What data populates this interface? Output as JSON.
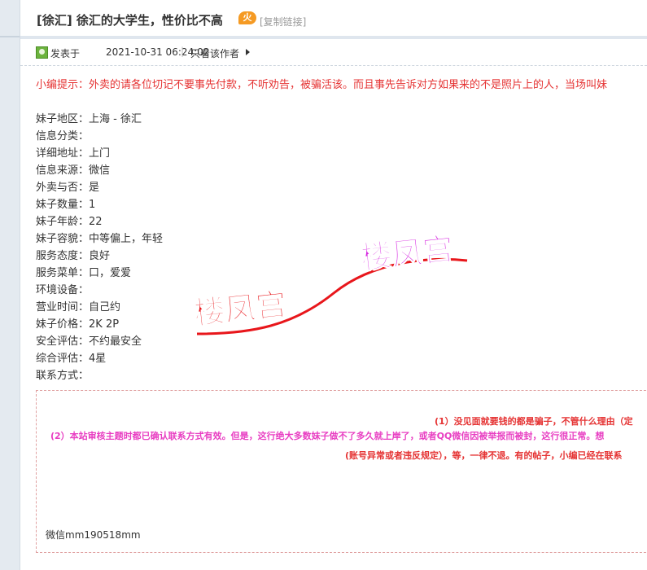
{
  "thread": {
    "title": "[徐汇] 徐汇的大学生，性价比不高",
    "hot_badge": "火",
    "copy_link": "[复制链接]"
  },
  "post_meta": {
    "posted_label": "发表于",
    "posted_time": "2021-10-31 06:24:02",
    "separator": "|",
    "only_author": "只看该作者"
  },
  "notice": "小编提示：外卖的请各位切记不要事先付款，不听劝告，被骗活该。而且事先告诉对方如果来的不是照片上的人，当场叫妹",
  "fields": [
    {
      "label": "妹子地区：",
      "value": "上海 - 徐汇"
    },
    {
      "label": "信息分类：",
      "value": ""
    },
    {
      "label": "详细地址：",
      "value": "上门"
    },
    {
      "label": "信息来源：",
      "value": "微信"
    },
    {
      "label": "外卖与否：",
      "value": "是"
    },
    {
      "label": "妹子数量：",
      "value": "1"
    },
    {
      "label": "妹子年龄：",
      "value": "22"
    },
    {
      "label": "妹子容貌：",
      "value": "中等偏上，年轻"
    },
    {
      "label": "服务态度：",
      "value": "良好"
    },
    {
      "label": "服务菜单：",
      "value": "口，爱爱"
    },
    {
      "label": "环境设备：",
      "value": ""
    },
    {
      "label": "营业时间：",
      "value": "自己约"
    },
    {
      "label": "妹子价格：",
      "value": "2K 2P"
    },
    {
      "label": "安全评估：",
      "value": "不约最安全"
    },
    {
      "label": "综合评估：",
      "value": "4星"
    },
    {
      "label": "联系方式：",
      "value": ""
    }
  ],
  "disclaimer": {
    "line1": "(1）没见面就要钱的都是骗子，不管什么理由（定",
    "line2": "(2）本站审核主题时都已确认联系方式有效。但是，这行绝大多数妹子做不了多久就上岸了，或者QQ微信因被举报而被封，这行很正常。想",
    "line3": "(账号异常或者违反规定），等，一律不退。有的帖子，小编已经在联系",
    "contact": "微信mm190518mm"
  },
  "watermark": {
    "text_left": "楼凤宫",
    "text_right": "楼凤宫",
    "color_left": "#e8161b",
    "color_right": "#d62ae0"
  },
  "colors": {
    "notice_red": "#e53333",
    "note_magenta": "#e83ec2",
    "hot_orange": "#f59a23",
    "author_green": "#6cb33e"
  }
}
